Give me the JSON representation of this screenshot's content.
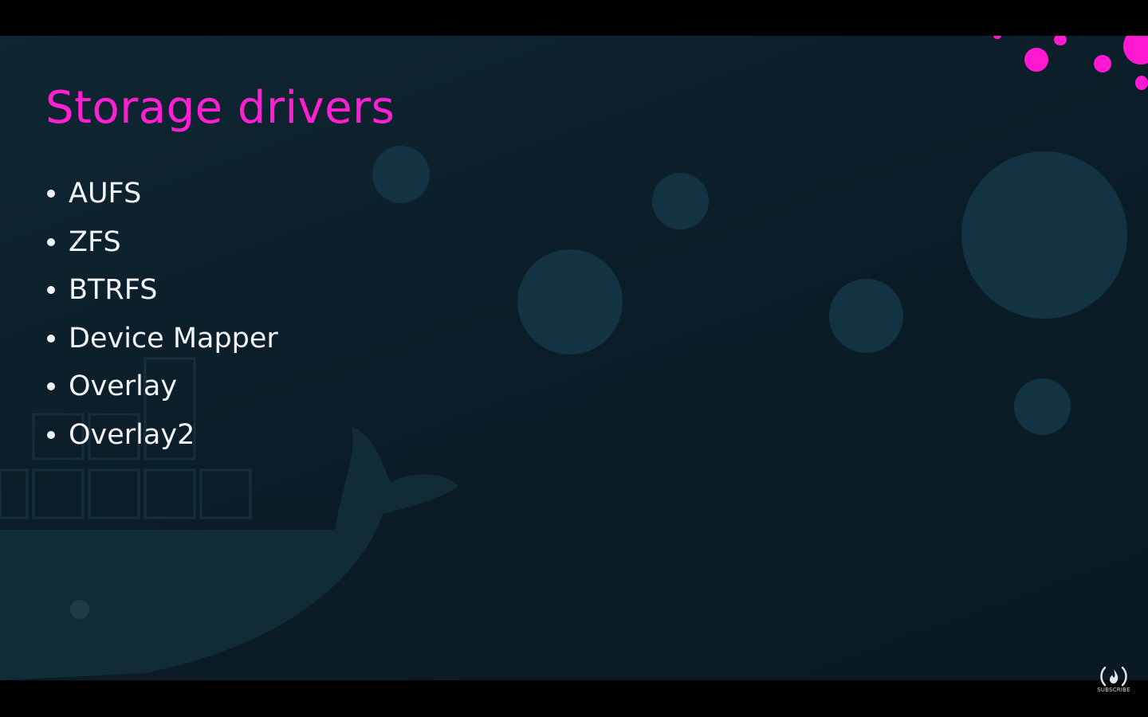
{
  "slide": {
    "title": "Storage drivers",
    "drivers": [
      "AUFS",
      "ZFS",
      "BTRFS",
      "Device Mapper",
      "Overlay",
      "Overlay2"
    ]
  },
  "overlay": {
    "subscribe_label": "SUBSCRIBE",
    "subscribe_icon": "freecodecamp-logo-icon"
  },
  "colors": {
    "title": "#ff1fd2",
    "text": "#f2f4f5",
    "background": "#0b1d28",
    "accent_dots": "#ff19d1"
  }
}
